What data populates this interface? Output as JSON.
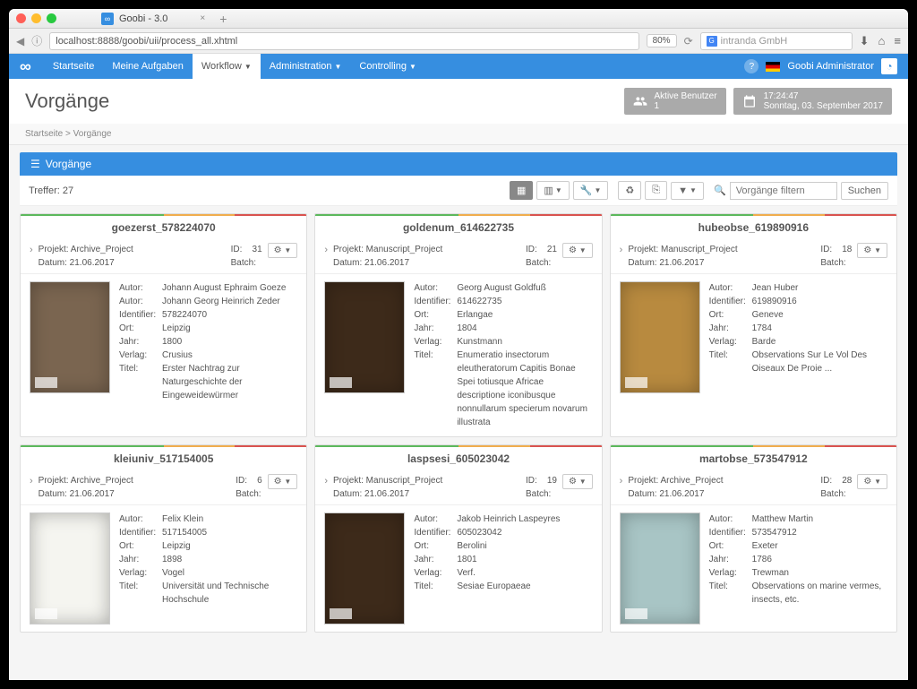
{
  "browser": {
    "tab_title": "Goobi - 3.0",
    "url": "localhost:8888/goobi/uii/process_all.xhtml",
    "zoom": "80%",
    "search_placeholder": "intranda GmbH"
  },
  "nav": {
    "items": [
      "Startseite",
      "Meine Aufgaben",
      "Workflow",
      "Administration",
      "Controlling"
    ],
    "user": "Goobi Administrator"
  },
  "header": {
    "title": "Vorgänge",
    "active_users_label": "Aktive Benutzer",
    "active_users_count": "1",
    "time": "17:24:47",
    "date": "Sonntag, 03. September 2017"
  },
  "breadcrumb": {
    "home": "Startseite",
    "current": "Vorgänge"
  },
  "panel": {
    "title": "Vorgänge",
    "treffer": "Treffer: 27",
    "filter_placeholder": "Vorgänge filtern",
    "search_btn": "Suchen"
  },
  "labels": {
    "projekt": "Projekt:",
    "datum": "Datum:",
    "id": "ID:",
    "batch": "Batch:",
    "autor": "Autor:",
    "identifier": "Identifier:",
    "ort": "Ort:",
    "jahr": "Jahr:",
    "verlag": "Verlag:",
    "titel": "Titel:"
  },
  "cards": [
    {
      "title": "goezerst_578224070",
      "projekt": "Archive_Project",
      "datum": "21.06.2017",
      "id": "31",
      "batch": "",
      "thumb": "tan-dark",
      "fields": [
        [
          "Autor",
          "Johann August Ephraim Goeze"
        ],
        [
          "Autor",
          "Johann Georg Heinrich Zeder"
        ],
        [
          "Identifier",
          "578224070"
        ],
        [
          "Ort",
          "Leipzig"
        ],
        [
          "Jahr",
          "1800"
        ],
        [
          "Verlag",
          "Crusius"
        ],
        [
          "Titel",
          "Erster Nachtrag zur Naturgeschichte der Eingeweidewürmer"
        ]
      ]
    },
    {
      "title": "goldenum_614622735",
      "projekt": "Manuscript_Project",
      "datum": "21.06.2017",
      "id": "21",
      "batch": "",
      "thumb": "brown",
      "fields": [
        [
          "Autor",
          "Georg August Goldfuß"
        ],
        [
          "Identifier",
          "614622735"
        ],
        [
          "Ort",
          "Erlangae"
        ],
        [
          "Jahr",
          "1804"
        ],
        [
          "Verlag",
          "Kunstmann"
        ],
        [
          "Titel",
          "Enumeratio insectorum eleutheratorum Capitis Bonae Spei totiusque Africae descriptione iconibusque nonnullarum specierum novarum illustrata"
        ]
      ]
    },
    {
      "title": "hubeobse_619890916",
      "projekt": "Manuscript_Project",
      "datum": "21.06.2017",
      "id": "18",
      "batch": "",
      "thumb": "tan",
      "fields": [
        [
          "Autor",
          "Jean Huber"
        ],
        [
          "Identifier",
          "619890916"
        ],
        [
          "Ort",
          "Geneve"
        ],
        [
          "Jahr",
          "1784"
        ],
        [
          "Verlag",
          "Barde"
        ],
        [
          "Titel",
          "Observations Sur Le Vol Des Oiseaux De Proie ..."
        ]
      ]
    },
    {
      "title": "kleiuniv_517154005",
      "projekt": "Archive_Project",
      "datum": "21.06.2017",
      "id": "6",
      "batch": "",
      "thumb": "white",
      "fields": [
        [
          "Autor",
          "Felix Klein"
        ],
        [
          "Identifier",
          "517154005"
        ],
        [
          "Ort",
          "Leipzig"
        ],
        [
          "Jahr",
          "1898"
        ],
        [
          "Verlag",
          "Vogel"
        ],
        [
          "Titel",
          "Universität und Technische Hochschule"
        ]
      ]
    },
    {
      "title": "laspsesi_605023042",
      "projekt": "Manuscript_Project",
      "datum": "21.06.2017",
      "id": "19",
      "batch": "",
      "thumb": "brown",
      "fields": [
        [
          "Autor",
          "Jakob Heinrich Laspeyres"
        ],
        [
          "Identifier",
          "605023042"
        ],
        [
          "Ort",
          "Berolini"
        ],
        [
          "Jahr",
          "1801"
        ],
        [
          "Verlag",
          "Verf."
        ],
        [
          "Titel",
          "Sesiae Europaeae"
        ]
      ]
    },
    {
      "title": "martobse_573547912",
      "projekt": "Archive_Project",
      "datum": "21.06.2017",
      "id": "28",
      "batch": "",
      "thumb": "blue",
      "fields": [
        [
          "Autor",
          "Matthew Martin"
        ],
        [
          "Identifier",
          "573547912"
        ],
        [
          "Ort",
          "Exeter"
        ],
        [
          "Jahr",
          "1786"
        ],
        [
          "Verlag",
          "Trewman"
        ],
        [
          "Titel",
          "Observations on marine vermes, insects, etc."
        ]
      ]
    }
  ]
}
